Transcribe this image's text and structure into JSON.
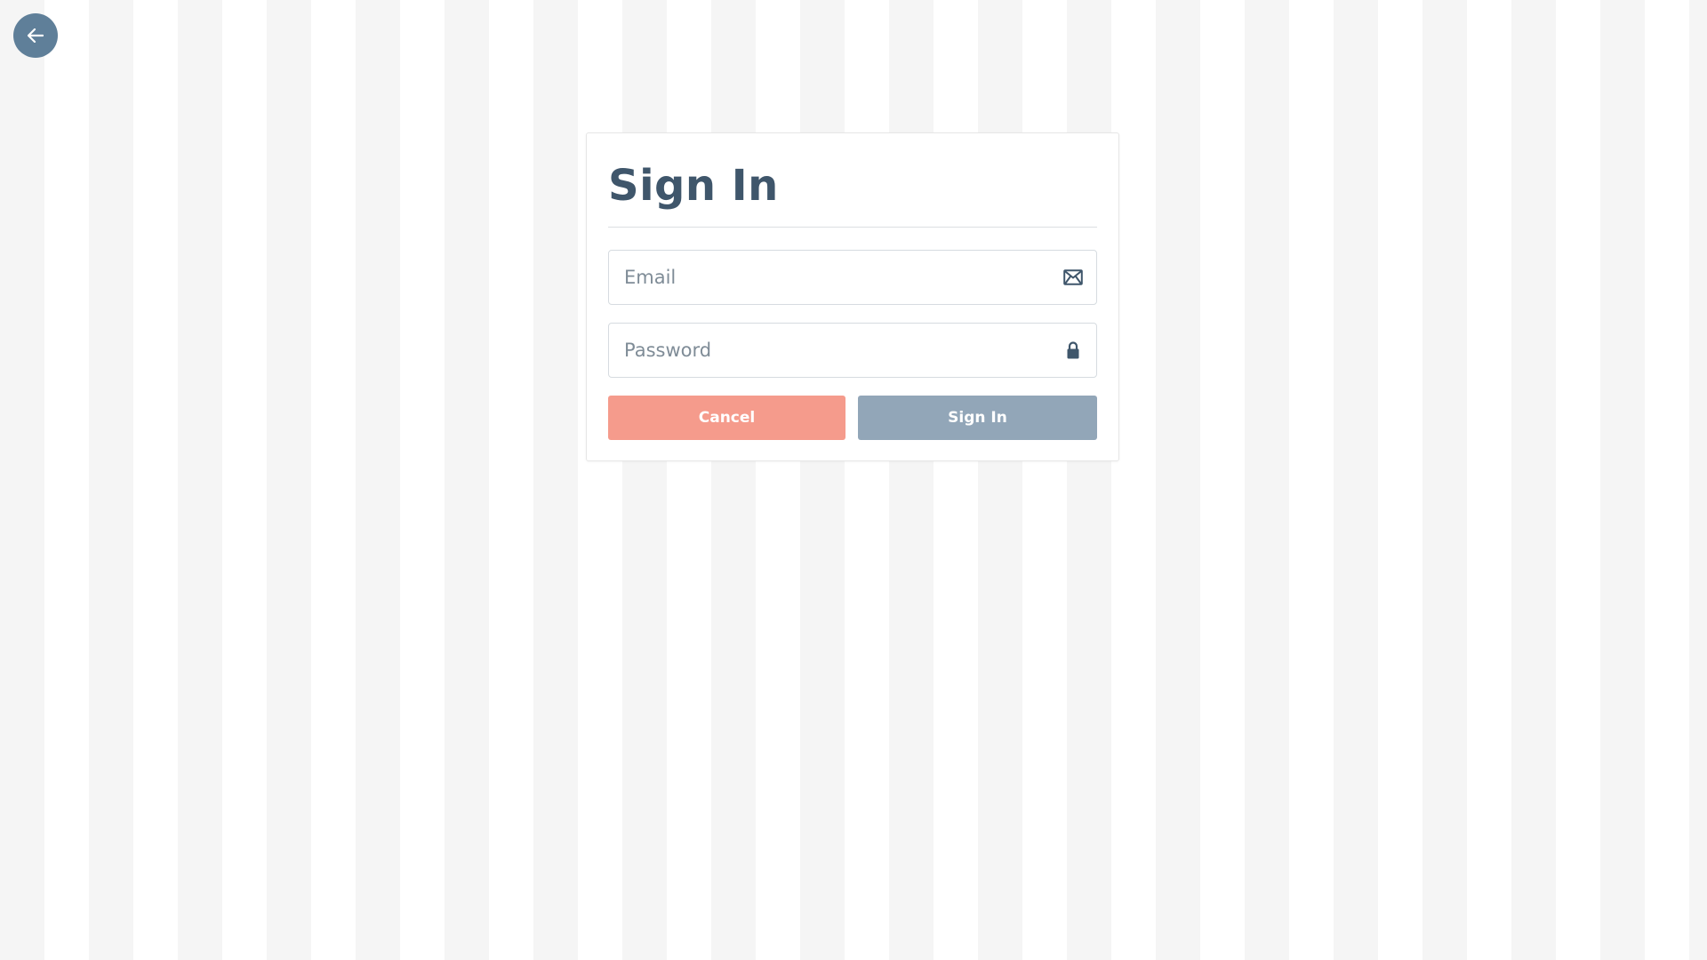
{
  "nav": {
    "back_icon": "arrow-left-icon",
    "back_color": "#5f7f99"
  },
  "signin": {
    "title": "Sign In",
    "email": {
      "placeholder": "Email",
      "value": "",
      "icon": "envelope-icon"
    },
    "password": {
      "placeholder": "Password",
      "value": "",
      "icon": "lock-icon"
    },
    "cancel_label": "Cancel",
    "submit_label": "Sign In"
  },
  "colors": {
    "title": "#3f566b",
    "cancel_button": "#f59b8c",
    "submit_button": "#92a6b8",
    "background_stripe_a": "#f5f5f5",
    "background_stripe_b": "#ffffff"
  }
}
